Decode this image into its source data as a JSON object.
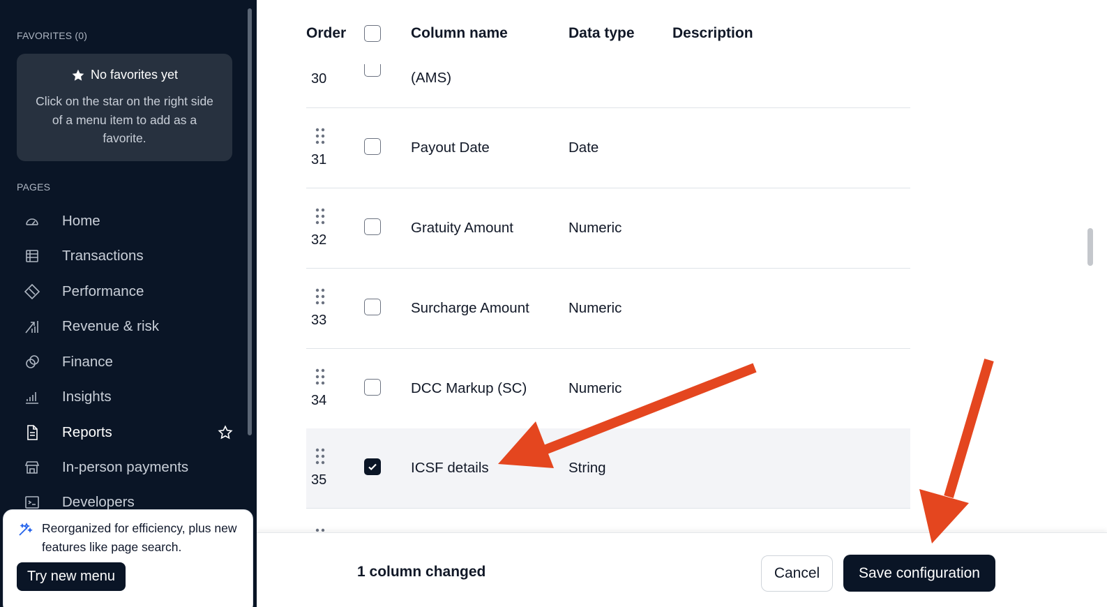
{
  "sidebar": {
    "favorites_label": "FAVORITES (0)",
    "favorites_card": {
      "title": "No favorites yet",
      "description": "Click on the star on the right side of a menu item to add as a favorite."
    },
    "pages_label": "PAGES",
    "items": [
      {
        "label": "Home",
        "icon": "home-gauge-icon"
      },
      {
        "label": "Transactions",
        "icon": "table-icon"
      },
      {
        "label": "Performance",
        "icon": "diamond-icon"
      },
      {
        "label": "Revenue & risk",
        "icon": "growth-chart-icon"
      },
      {
        "label": "Finance",
        "icon": "coins-icon"
      },
      {
        "label": "Insights",
        "icon": "bar-chart-icon"
      },
      {
        "label": "Reports",
        "icon": "document-icon",
        "active": true
      },
      {
        "label": "In-person payments",
        "icon": "store-icon"
      },
      {
        "label": "Developers",
        "icon": "terminal-icon"
      }
    ],
    "promo": {
      "text": "Reorganized for efficiency, plus new features like page search.",
      "button": "Try new menu"
    }
  },
  "table": {
    "headers": {
      "order": "Order",
      "column_name": "Column name",
      "data_type": "Data type",
      "description": "Description"
    },
    "partial_row_top": {
      "order": "30",
      "name": "(AMS)"
    },
    "rows": [
      {
        "order": "31",
        "name": "Payout Date",
        "type": "Date",
        "checked": false
      },
      {
        "order": "32",
        "name": "Gratuity Amount",
        "type": "Numeric",
        "checked": false
      },
      {
        "order": "33",
        "name": "Surcharge Amount",
        "type": "Numeric",
        "checked": false
      },
      {
        "order": "34",
        "name": "DCC Markup (SC)",
        "type": "Numeric",
        "checked": false
      },
      {
        "order": "35",
        "name": "ICSF details",
        "type": "String",
        "checked": true
      }
    ]
  },
  "footer": {
    "status": "1 column changed",
    "cancel": "Cancel",
    "save": "Save configuration"
  },
  "colors": {
    "sidebar_bg": "#0a1526",
    "accent_arrow": "#e4461f",
    "row_highlight": "#f3f4f7"
  }
}
